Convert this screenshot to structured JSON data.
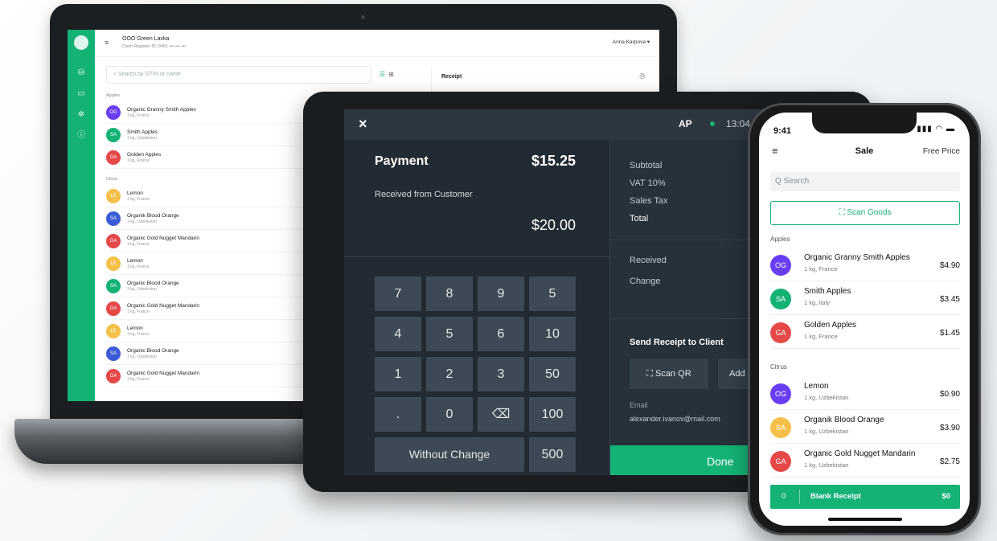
{
  "colors": {
    "brand_green": "#15b275",
    "tablet_bg": "#222b33",
    "key_bg": "#3d4a55"
  },
  "laptop": {
    "store_name": "ООО Green Lavka",
    "store_sub": "Cash Register ID: 0451 ••• ••• •••",
    "user": "Anna Karpova ▾",
    "search_placeholder": "Search by GTIN or name",
    "receipt_title": "Receipt",
    "groups": [
      {
        "label": "Apples",
        "items": [
          {
            "initials": "OG",
            "name": "Organic Granny Smith Apples",
            "sub": "1 kg, France",
            "color": "#6a3df2"
          },
          {
            "initials": "SA",
            "name": "Smith Apples",
            "sub": "1 kg, Uzbekistan",
            "color": "#15b275"
          },
          {
            "initials": "GA",
            "name": "Golden Apples",
            "sub": "1 kg, France",
            "color": "#e54848"
          }
        ]
      },
      {
        "label": "Citrus",
        "items": [
          {
            "initials": "LE",
            "name": "Lemon",
            "sub": "1 kg, France",
            "color": "#f5c04a"
          },
          {
            "initials": "SA",
            "name": "Organik Blood Orange",
            "sub": "1 kg, Uzbekistan",
            "color": "#3b5bd6"
          },
          {
            "initials": "GA",
            "name": "Organic Gold Nugget Mandarin",
            "sub": "1 kg, France",
            "color": "#e54848"
          },
          {
            "initials": "LE",
            "name": "Lemon",
            "sub": "1 kg, France",
            "color": "#f5c04a"
          },
          {
            "initials": "SA",
            "name": "Organic Blood Orange",
            "sub": "1 kg, Uzbekistan",
            "color": "#15b275"
          },
          {
            "initials": "GA",
            "name": "Organic Gold Nugget Mandarin",
            "sub": "1 kg, France",
            "color": "#e54848"
          },
          {
            "initials": "LE",
            "name": "Lemon",
            "sub": "1 kg, France",
            "color": "#f5c04a"
          },
          {
            "initials": "SA",
            "name": "Organic Blood Orange",
            "sub": "1 kg, Uzbekistan",
            "color": "#3b5bd6"
          },
          {
            "initials": "GA",
            "name": "Organic Gold Nugget Mandarin",
            "sub": "1 kg, France",
            "color": "#e54848"
          }
        ]
      }
    ]
  },
  "tablet": {
    "close_icon": "×",
    "user_initials": "AP",
    "time": "13:04",
    "payment_label": "Payment",
    "payment_amount": "$15.25",
    "received_label": "Received from Customer",
    "received_amount": "$20.00",
    "keys": [
      "7",
      "8",
      "9",
      "5",
      "4",
      "5",
      "6",
      "10",
      "1",
      "2",
      "3",
      "50",
      ".",
      "0",
      "⌫",
      "100"
    ],
    "without_change": "Without Change",
    "key_500": "500",
    "summary": [
      "Subtotal",
      "VAT 10%",
      "Sales Tax",
      "Total"
    ],
    "received": "Received",
    "change": "Change",
    "send_receipt": "Send Receipt to Client",
    "scan_qr": "⛶ Scan QR",
    "add": "Add",
    "email_label": "Email",
    "email_value": "alexander.ivanov@mail.com",
    "done": "Done"
  },
  "phone": {
    "time": "9:41",
    "status_icons": "▮▮▮ ◠ ▬",
    "title": "Sale",
    "free_price": "Free Price",
    "search_placeholder": "Q Search",
    "scan_goods": "⛶  Scan Goods",
    "group_apples": "Apples",
    "group_citrus": "Citrus",
    "apples": [
      {
        "initials": "OG",
        "name": "Organic Granny Smith Apples",
        "sub": "1 kg, France",
        "price": "$4.90",
        "color": "#6a3df2"
      },
      {
        "initials": "SA",
        "name": "Smith Apples",
        "sub": "1 kg, Italy",
        "price": "$3.45",
        "color": "#15b275"
      },
      {
        "initials": "GA",
        "name": "Golden Apples",
        "sub": "1 kg, France",
        "price": "$1.45",
        "color": "#e54848"
      }
    ],
    "citrus": [
      {
        "initials": "OG",
        "name": "Lemon",
        "sub": "1 kg, Uzbekistan",
        "price": "$0.90",
        "color": "#6a3df2"
      },
      {
        "initials": "SA",
        "name": "Organik Blood Orange",
        "sub": "1 kg, Uzbekistan",
        "price": "$3.90",
        "color": "#f5c04a"
      },
      {
        "initials": "GA",
        "name": "Organic Gold Nugget Mandarin",
        "sub": "1 kg, Uzbekistan",
        "price": "$2.75",
        "color": "#e54848"
      }
    ],
    "blank_count": "0",
    "blank_label": "Blank Receipt",
    "blank_amount": "$0"
  }
}
